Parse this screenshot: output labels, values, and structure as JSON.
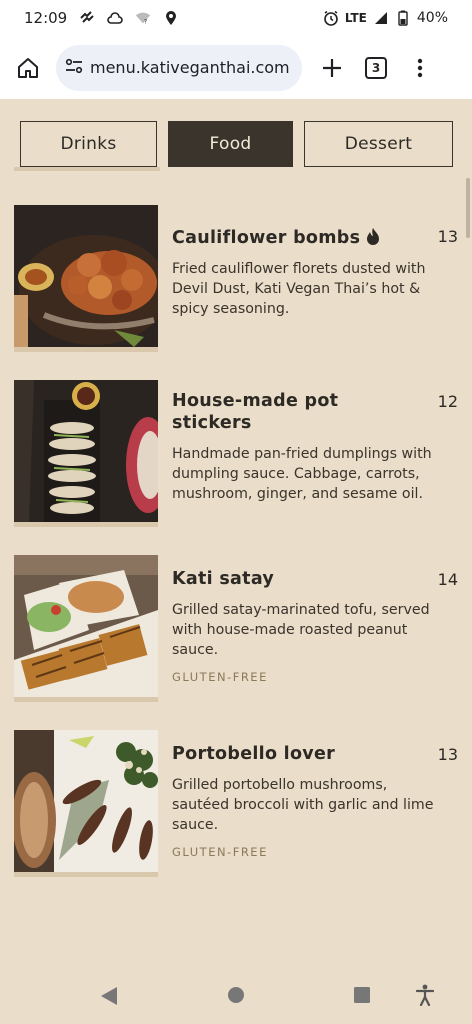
{
  "status": {
    "time": "12:09",
    "network": "LTE",
    "battery": "40%"
  },
  "browser": {
    "url": "menu.kativeganthai.com",
    "tab_count": "3"
  },
  "tabs": [
    {
      "label": "Drinks",
      "active": false
    },
    {
      "label": "Food",
      "active": true
    },
    {
      "label": "Dessert",
      "active": false
    }
  ],
  "items": [
    {
      "name": "Cauliflower bombs",
      "price": "13",
      "description": [
        "Fried cauliflower florets dusted with",
        "Devil Dust, Kati Vegan Thai’s hot &",
        "spicy seasoning."
      ],
      "tag": "",
      "spicy": true
    },
    {
      "name_lines": [
        "House-made pot",
        "stickers"
      ],
      "price": "12",
      "description": [
        "Handmade pan-fried dumplings with",
        "dumpling sauce. Cabbage, carrots,",
        "mushroom, ginger, and sesame oil."
      ],
      "tag": ""
    },
    {
      "name": "Kati satay",
      "price": "14",
      "description": [
        "Grilled satay-marinated tofu, served",
        "with house-made roasted peanut",
        "sauce."
      ],
      "tag": "GLUTEN-FREE"
    },
    {
      "name": "Portobello lover",
      "price": "13",
      "description": [
        "Grilled portobello mushrooms,",
        "sautéed broccoli with garlic and lime",
        "sauce."
      ],
      "tag": "GLUTEN-FREE"
    }
  ]
}
